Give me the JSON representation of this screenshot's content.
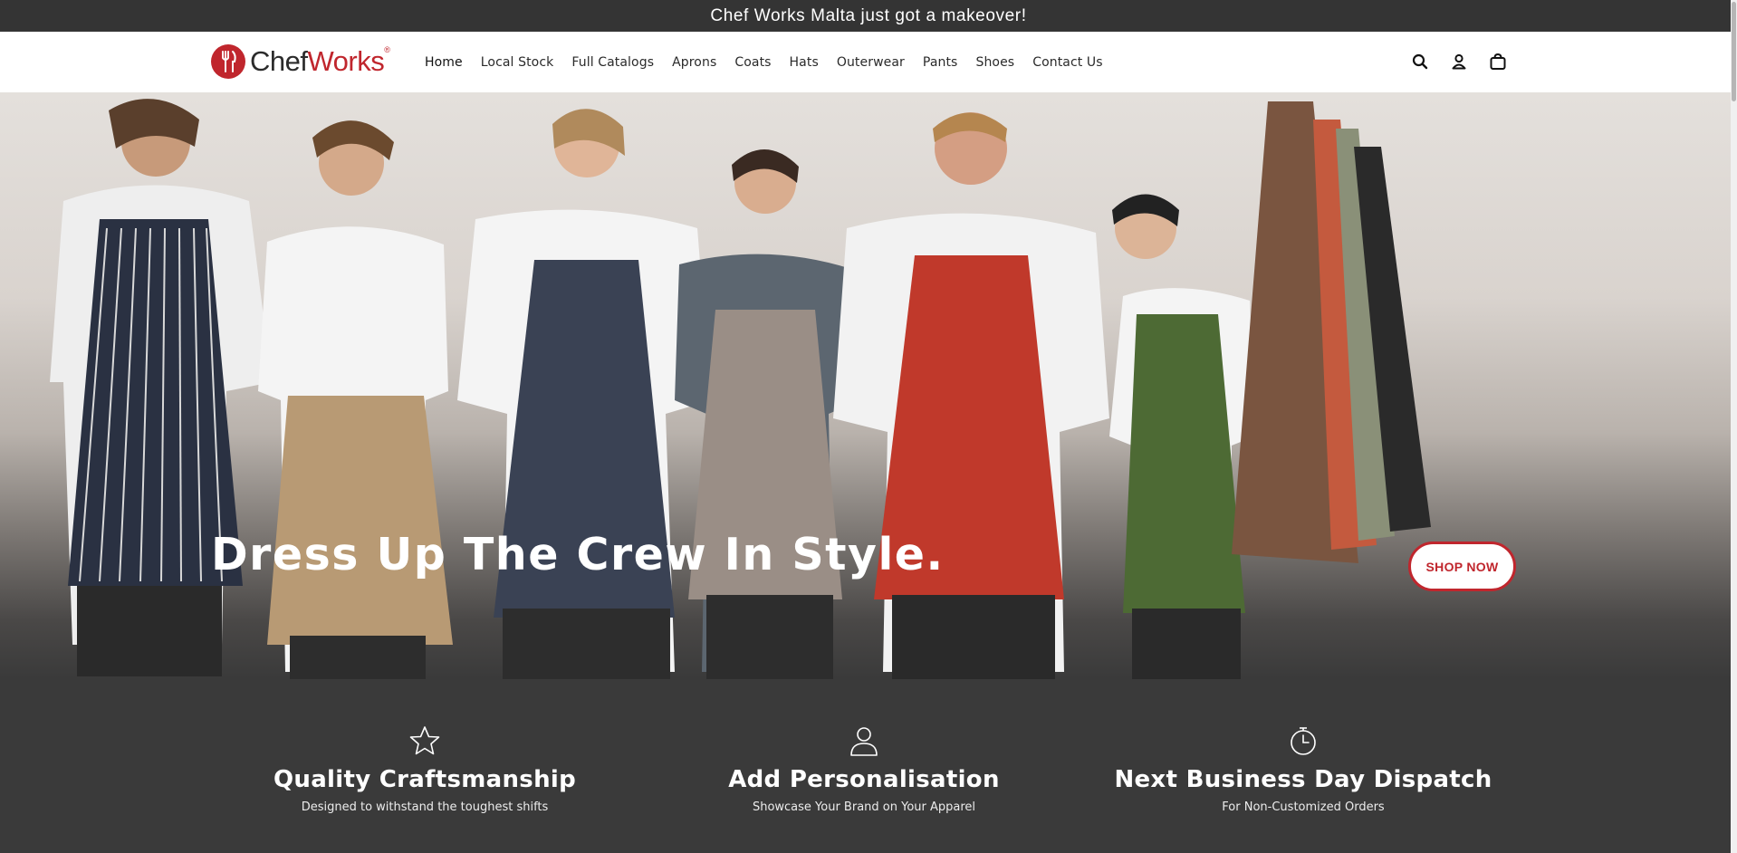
{
  "announcement": {
    "text": "Chef Works Malta just got a makeover!"
  },
  "brand": {
    "word1": "Chef",
    "word2": "Works",
    "mark": "®",
    "accent": "#c0262d"
  },
  "nav": {
    "items": [
      {
        "label": "Home"
      },
      {
        "label": "Local Stock"
      },
      {
        "label": "Full Catalogs"
      },
      {
        "label": "Aprons"
      },
      {
        "label": "Coats"
      },
      {
        "label": "Hats"
      },
      {
        "label": "Outerwear"
      },
      {
        "label": "Pants"
      },
      {
        "label": "Shoes"
      },
      {
        "label": "Contact Us"
      }
    ]
  },
  "header_icons": [
    "search-icon",
    "account-icon",
    "cart-icon"
  ],
  "hero": {
    "title": "Dress Up The Crew In Style.",
    "cta": "SHOP NOW"
  },
  "features": [
    {
      "icon": "star-icon",
      "title": "Quality Craftsmanship",
      "subtitle": "Designed to withstand the toughest shifts"
    },
    {
      "icon": "person-icon",
      "title": "Add Personalisation",
      "subtitle": "Showcase Your Brand on Your Apparel"
    },
    {
      "icon": "stopwatch-icon",
      "title": "Next Business Day Dispatch",
      "subtitle": "For Non-Customized Orders"
    }
  ],
  "colors": {
    "dark": "#3a3a3a",
    "accent": "#c0262d",
    "header_bg": "#ffffff"
  }
}
